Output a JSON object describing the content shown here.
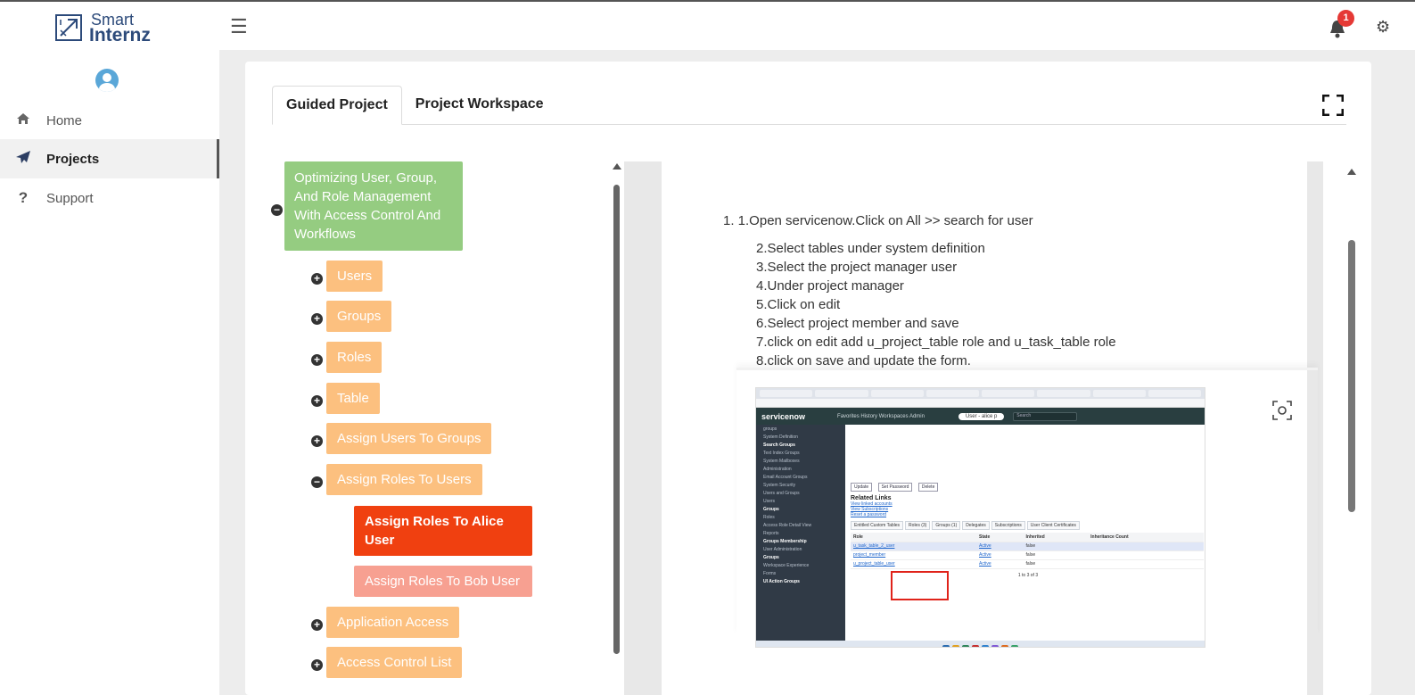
{
  "app": {
    "logo_line1": "Smart",
    "logo_line2": "Internz",
    "notification_count": "1"
  },
  "sidebar": {
    "items": [
      {
        "label": "Home",
        "icon": "home-icon"
      },
      {
        "label": "Projects",
        "icon": "paper-plane-icon",
        "active": true
      },
      {
        "label": "Support",
        "icon": "question-icon"
      }
    ]
  },
  "tabs": [
    {
      "label": "Guided Project",
      "active": true
    },
    {
      "label": "Project Workspace",
      "active": false
    }
  ],
  "tree": {
    "root": {
      "label": "Optimizing User, Group, And Role Management With Access Control And Workflows",
      "toggle": "−"
    },
    "children": [
      {
        "label": "Users",
        "toggle": "+"
      },
      {
        "label": "Groups",
        "toggle": "+"
      },
      {
        "label": "Roles",
        "toggle": "+"
      },
      {
        "label": "Table",
        "toggle": "+"
      },
      {
        "label": "Assign Users To Groups",
        "toggle": "+"
      },
      {
        "label": "Assign Roles To Users",
        "toggle": "−"
      },
      {
        "label": "Application Access",
        "toggle": "+"
      },
      {
        "label": "Access Control List",
        "toggle": "+"
      }
    ],
    "subchildren": [
      {
        "label": "Assign Roles To Alice User",
        "selected": true
      },
      {
        "label": "Assign Roles To Bob User",
        "selected": false
      }
    ]
  },
  "content": {
    "step1": "1. 1.Open servicenow.Click on All  >> search for user",
    "steps": [
      "2.Select tables under system definition",
      "3.Select the project manager user",
      "4.Under project manager",
      "5.Click on edit",
      "6.Select project member and save",
      "7.click on edit add u_project_table role and u_task_table role",
      "8.click on save and  update the form."
    ]
  },
  "embedded_screenshot": {
    "brand": "servicenow",
    "menu": "Favorites   History   Workspaces   Admin",
    "user_pill": "User - alice p",
    "search": "Search",
    "nav_items": [
      "groups",
      "System Definition",
      "Search Groups",
      "Text Index Groups",
      "System Mailboxes",
      "Administration",
      "Email Account Groups",
      "System Security",
      "Users and Groups",
      "Users",
      "Groups",
      "Roles",
      "Access Role Detail View",
      "Reports",
      "Groups Membership",
      "User Administration",
      "Groups",
      "Workspace Experience",
      "Forms",
      "UI Action Groups"
    ],
    "buttons": [
      "Update",
      "Set Password",
      "Delete"
    ],
    "related_links_title": "Related Links",
    "related_links": [
      "View linked accounts",
      "View Subscriptions",
      "Reset a password"
    ],
    "related_tabs": [
      "Entitled Custom Tables",
      "Roles (3)",
      "Groups (1)",
      "Delegates",
      "Subscriptions",
      "User Client Certificates"
    ],
    "grid_headers": [
      "Role",
      "State",
      "Inherited",
      "Inheritance Count"
    ],
    "grid_rows": [
      [
        "u_task_table_2_user",
        "Active",
        "false",
        ""
      ],
      [
        "project_member",
        "Active",
        "false",
        ""
      ],
      [
        "u_project_table_user",
        "Active",
        "false",
        ""
      ]
    ],
    "pagination": "1 to 3 of 3"
  },
  "colors": {
    "root_node": "#95cc81",
    "child_node": "#fcc07f",
    "selected_node": "#f04010",
    "sibling_node": "#f7a091",
    "brand": "#2c4a7a"
  }
}
